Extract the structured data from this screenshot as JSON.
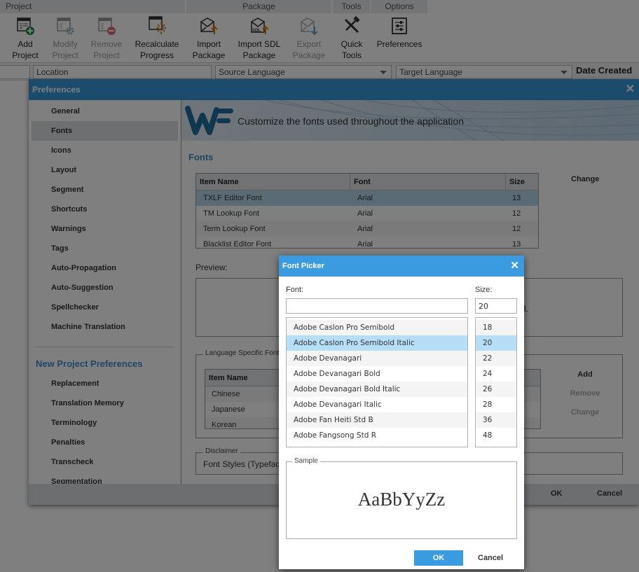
{
  "ribbon": {
    "groups": [
      "Project",
      "Package",
      "Tools",
      "Options"
    ],
    "buttons": [
      {
        "label_line1": "Add",
        "label_line2": "Project",
        "icon": "add-project-icon",
        "enabled": true
      },
      {
        "label_line1": "Modify",
        "label_line2": "Project",
        "icon": "modify-project-icon",
        "enabled": false
      },
      {
        "label_line1": "Remove",
        "label_line2": "Project",
        "icon": "remove-project-icon",
        "enabled": false
      },
      {
        "label_line1": "Recalculate",
        "label_line2": "Progress",
        "icon": "recalculate-progress-icon",
        "enabled": true
      },
      {
        "label_line1": "Import",
        "label_line2": "Package",
        "icon": "import-package-icon",
        "enabled": true
      },
      {
        "label_line1": "Import SDL",
        "label_line2": "Package",
        "icon": "import-sdl-package-icon",
        "enabled": true
      },
      {
        "label_line1": "Export",
        "label_line2": "Package",
        "icon": "export-package-icon",
        "enabled": false
      },
      {
        "label_line1": "Quick",
        "label_line2": "Tools",
        "icon": "quick-tools-icon",
        "enabled": true
      },
      {
        "label_line1": "Preferences",
        "label_line2": "",
        "icon": "preferences-icon",
        "enabled": true
      }
    ]
  },
  "filters": {
    "location_placeholder": "Location",
    "source_language": "Source Language",
    "target_language": "Target Language",
    "date_created_header": "Date Created"
  },
  "preferences": {
    "title": "Preferences",
    "sidebar": {
      "items": [
        "General",
        "Fonts",
        "Icons",
        "Layout",
        "Segment",
        "Shortcuts",
        "Warnings",
        "Tags",
        "Auto-Propagation",
        "Auto-Suggestion",
        "Spellchecker",
        "Machine Translation"
      ],
      "active": "Fonts",
      "new_project_heading": "New Project Preferences",
      "new_project_items": [
        "Replacement",
        "Translation Memory",
        "Terminology",
        "Penalties",
        "Transcheck",
        "Segmentation"
      ]
    },
    "banner_text": "Customize the fonts used throughout the application",
    "section_title": "Fonts",
    "fonts_table": {
      "headers": [
        "Item Name",
        "Font",
        "Size"
      ],
      "rows": [
        {
          "item": "TXLF Editor Font",
          "font": "Arial",
          "size": "13",
          "selected": true
        },
        {
          "item": "TM Lookup Font",
          "font": "Arial",
          "size": "12",
          "selected": false
        },
        {
          "item": "Term Lookup Font",
          "font": "Arial",
          "size": "12",
          "selected": false
        },
        {
          "item": "Blacklist Editor Font",
          "font": "Arial",
          "size": "13",
          "selected": false
        }
      ]
    },
    "change_label": "Change",
    "preview_label": "Preview:",
    "preview_fragment": "l.",
    "language_fonts": {
      "legend": "Language Specific Font",
      "header": "Item Name",
      "rows": [
        "Chinese",
        "Japanese",
        "Korean"
      ],
      "add_label": "Add",
      "remove_label": "Remove",
      "change_label": "Change"
    },
    "disclaimer": {
      "legend": "Disclaimer",
      "text": "Font Styles (Typeface"
    },
    "ok_label": "OK",
    "cancel_label": "Cancel"
  },
  "font_picker": {
    "title": "Font Picker",
    "font_label": "Font:",
    "size_label": "Size:",
    "font_input_value": "",
    "size_input_value": "20",
    "fonts": [
      "Adobe Caslon Pro Semibold",
      "Adobe Caslon Pro Semibold Italic",
      "Adobe Devanagari",
      "Adobe Devanagari Bold",
      "Adobe Devanagari Bold Italic",
      "Adobe Devanagari Italic",
      "Adobe Fan Heiti Std B",
      "Adobe Fangsong Std R"
    ],
    "selected_font": "Adobe Caslon Pro Semibold Italic",
    "sizes": [
      "18",
      "20",
      "22",
      "24",
      "26",
      "28",
      "36",
      "48"
    ],
    "selected_size": "20",
    "sample_legend": "Sample",
    "sample_text": "AaBbYyZz",
    "ok_label": "OK",
    "cancel_label": "Cancel"
  },
  "colors": {
    "accent": "#3a9be0",
    "selection": "#b6def7",
    "heading_blue": "#3f8fc8"
  }
}
